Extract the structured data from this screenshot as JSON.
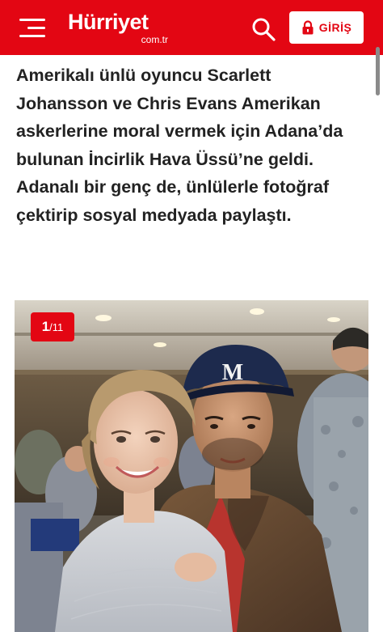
{
  "header": {
    "logo_main": "Hürriyet",
    "logo_sub": "com.tr",
    "login_label": "GİRİŞ",
    "brand_color": "#e30613",
    "icons": [
      "menu-icon",
      "search-icon",
      "lock-icon"
    ]
  },
  "article": {
    "summary": "Amerikalı ünlü oyuncu Scarlett Johansson ve Chris Evans Amerikan askerlerine moral vermek için Adana’da bulunan İncirlik Hava Üssü’ne geldi. Adanalı bir genç de, ünlülerle fotoğraf çektirip sosyal medyada paylaştı."
  },
  "gallery": {
    "current": "1",
    "separator": "/",
    "total": "11",
    "cap_letter": "M"
  }
}
